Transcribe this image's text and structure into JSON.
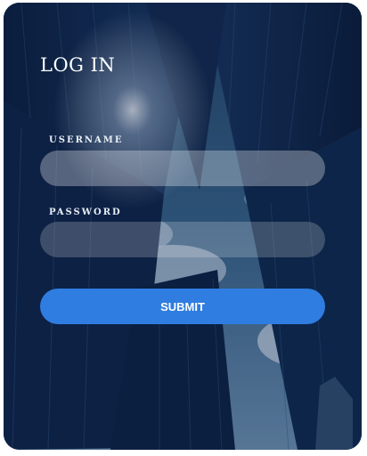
{
  "login_card": {
    "title": "LOG IN",
    "username": {
      "label": "USERNAME",
      "value": "",
      "placeholder": ""
    },
    "password": {
      "label": "PASSWORD",
      "value": "",
      "placeholder": ""
    },
    "submit_label": "SUBMIT",
    "colors": {
      "accent": "#2f7de1",
      "text": "#ffffff",
      "overlay": "#0a1e46"
    },
    "background": "city-skyscrapers-looking-up-photo"
  }
}
